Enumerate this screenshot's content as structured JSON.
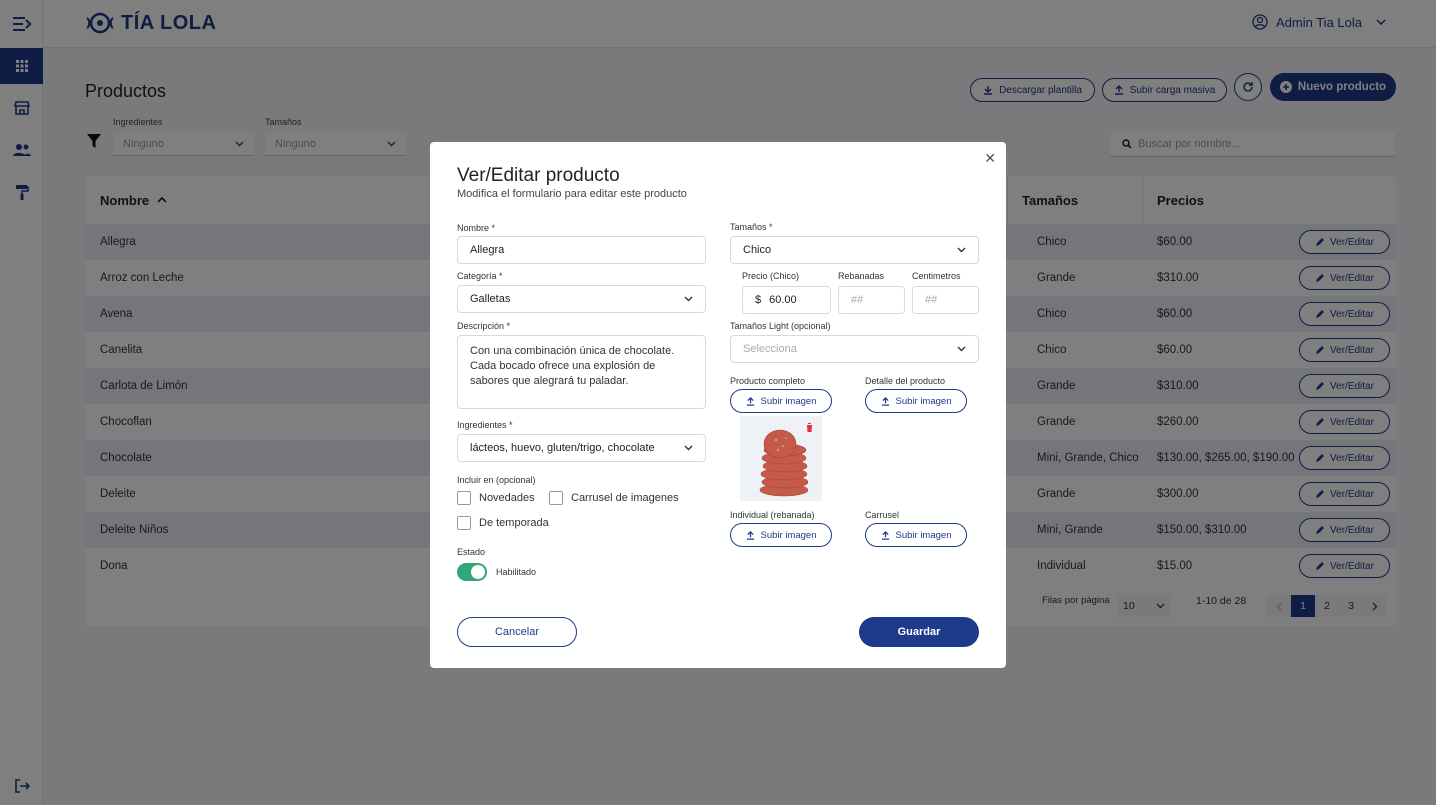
{
  "brand": {
    "name": "TÍA LOLA"
  },
  "user": {
    "name": "Admin Tia Lola"
  },
  "page": {
    "title": "Productos"
  },
  "actions": {
    "download_template": "Descargar plantilla",
    "bulk_upload": "Subir carga masiva",
    "new_product": "Nuevo producto"
  },
  "filters": {
    "ingredients_label": "Ingredientes",
    "ingredients_value": "Ninguno",
    "sizes_label": "Tamaños",
    "sizes_value": "Ninguno",
    "search_placeholder": "Buscar por nombre..."
  },
  "table": {
    "columns": {
      "name": "Nombre",
      "sizes": "Tamaños",
      "prices": "Precios"
    },
    "edit_label": "Ver/Editar",
    "rows": [
      {
        "name": "Allegra",
        "sizes": "Chico",
        "prices": "$60.00"
      },
      {
        "name": "Arroz con Leche",
        "sizes": "Grande",
        "prices": "$310.00"
      },
      {
        "name": "Avena",
        "sizes": "Chico",
        "prices": "$60.00"
      },
      {
        "name": "Canelita",
        "sizes": "Chico",
        "prices": "$60.00"
      },
      {
        "name": "Carlota de Limón",
        "sizes": "Grande",
        "prices": "$310.00"
      },
      {
        "name": "Chocoflan",
        "sizes": "Grande",
        "prices": "$260.00"
      },
      {
        "name": "Chocolate",
        "sizes": "Mini, Grande, Chico",
        "prices": "$130.00, $265.00, $190.00"
      },
      {
        "name": "Deleite",
        "sizes": "Grande",
        "prices": "$300.00"
      },
      {
        "name": "Deleite Niños",
        "sizes": "Mini, Grande",
        "prices": "$150.00, $310.00"
      },
      {
        "name": "Dona",
        "sizes": "Individual",
        "prices": "$15.00"
      }
    ],
    "pagination": {
      "rows_per_page_label": "Filas por página",
      "rows_per_page": "10",
      "range": "1-10 de 28",
      "pages": [
        "1",
        "2",
        "3"
      ]
    }
  },
  "modal": {
    "title": "Ver/Editar producto",
    "subtitle": "Modifica el formulario para editar este producto",
    "name_label": "Nombre *",
    "name_value": "Allegra",
    "category_label": "Categoría *",
    "category_value": "Galletas",
    "description_label": "Descripción *",
    "description_value": "Con una combinación única de chocolate. Cada bocado ofrece una explosión de sabores que alegrará tu paladar.",
    "ingredients_label": "Ingredientes *",
    "ingredients_value": "lácteos, huevo, gluten/trigo, chocolate",
    "include_label": "Incluir en (opcional)",
    "include_options": [
      "Novedades",
      "Carrusel de imagenes",
      "De temporada"
    ],
    "status_label": "Estado",
    "status_value": "Habilitado",
    "sizes_label": "Tamaños *",
    "sizes_value": "Chico",
    "price_label": "Precio (Chico)",
    "price_currency": "$",
    "price_value": "60.00",
    "slices_label": "Rebanadas",
    "slices_placeholder": "##",
    "cm_label": "Centimetros",
    "cm_placeholder": "##",
    "light_sizes_label": "Tamaños Light (opcional)",
    "light_sizes_placeholder": "Selecciona",
    "img_full_label": "Producto completo",
    "img_detail_label": "Detalle del producto",
    "img_single_label": "Individual (rebanada)",
    "img_carousel_label": "Carrusel",
    "upload_label": "Subir imagen",
    "cancel_label": "Cancelar",
    "save_label": "Guardar"
  },
  "colors": {
    "primary": "#1e3a8a",
    "toggle_on": "#34a77a",
    "row_alt": "#e8edf8"
  }
}
